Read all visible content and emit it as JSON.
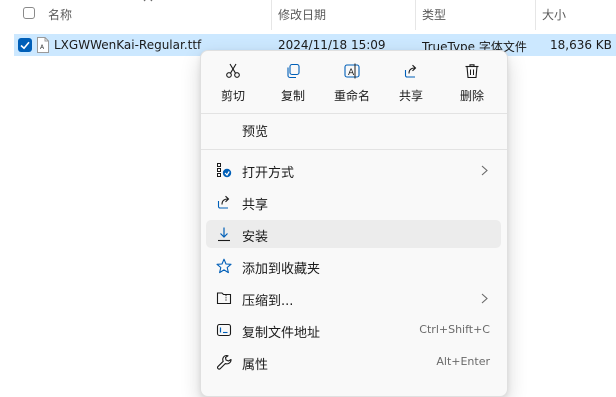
{
  "list": {
    "headers": {
      "name": "名称",
      "modified": "修改日期",
      "type": "类型",
      "size": "大小"
    },
    "files": [
      {
        "name": "LXGWWenKai-Regular.ttf",
        "modified": "2024/11/18 15:09",
        "type": "TrueType 字体文件",
        "size": "18,636 KB",
        "selected": true
      }
    ]
  },
  "menu": {
    "quick_actions": [
      {
        "label": "剪切",
        "icon": "scissors-icon"
      },
      {
        "label": "复制",
        "icon": "copy-icon"
      },
      {
        "label": "重命名",
        "icon": "rename-icon"
      },
      {
        "label": "共享",
        "icon": "share-icon"
      },
      {
        "label": "删除",
        "icon": "trash-icon"
      }
    ],
    "preview": "预览",
    "items": [
      {
        "label": "打开方式",
        "icon": "open-with-icon",
        "submenu": true
      },
      {
        "label": "共享",
        "icon": "share-icon"
      },
      {
        "label": "安装",
        "icon": "install-icon",
        "hover": true
      },
      {
        "label": "添加到收藏夹",
        "icon": "star-icon"
      },
      {
        "label": "压缩到...",
        "icon": "zip-folder-icon",
        "submenu": true
      },
      {
        "label": "复制文件地址",
        "icon": "copy-path-icon",
        "shortcut": "Ctrl+Shift+C"
      },
      {
        "label": "属性",
        "icon": "wrench-icon",
        "shortcut": "Alt+Enter"
      }
    ]
  },
  "colors": {
    "selection": "#cce8ff",
    "accent": "#005fb8",
    "menu_bg": "#f9f9f9",
    "hover": "#ececec"
  }
}
